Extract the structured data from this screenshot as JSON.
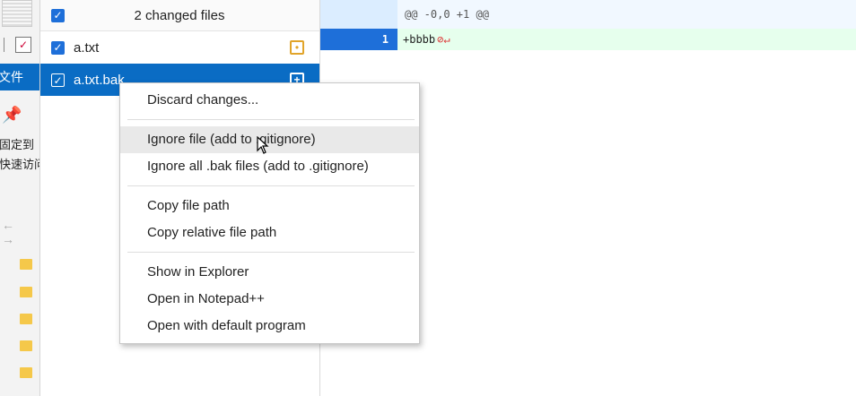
{
  "explorer": {
    "selected_label": "文件",
    "pin_label": "固定到\n快速访问",
    "pin_icon": "pin-icon",
    "nav_arrows": "← →"
  },
  "files": {
    "header": {
      "checked": true,
      "title": "2 changed files"
    },
    "items": [
      {
        "name": "a.txt",
        "checked": true,
        "status": "modified",
        "badge": "•"
      },
      {
        "name": "a.txt.bak",
        "checked": true,
        "status": "added",
        "badge": "+",
        "selected": true
      }
    ]
  },
  "diff": {
    "hunk_header": "@@ -0,0 +1 @@",
    "lines": [
      {
        "new_line_number": "1",
        "text": "+bbbb"
      }
    ]
  },
  "context_menu": {
    "items": [
      {
        "label": "Discard changes..."
      },
      {
        "label": "Ignore file (add to .gitignore)",
        "hovered": true
      },
      {
        "label": "Ignore all .bak files (add to .gitignore)"
      },
      {
        "label": "Copy file path"
      },
      {
        "label": "Copy relative file path"
      },
      {
        "label": "Show in Explorer"
      },
      {
        "label": "Open in Notepad++"
      },
      {
        "label": "Open with default program"
      }
    ]
  },
  "colors": {
    "selection": "#0a6cc4",
    "checkbox": "#1e6fd9",
    "modified_badge": "#e1a42a",
    "added_line_bg": "#e6ffed"
  }
}
